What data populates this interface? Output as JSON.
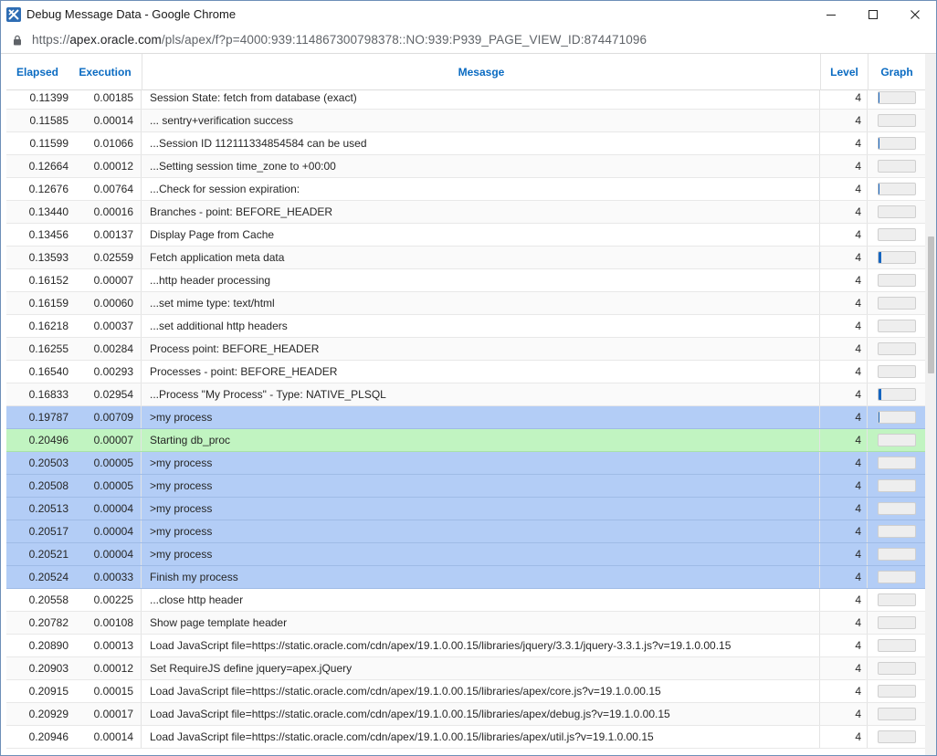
{
  "window": {
    "title": "Debug Message Data - Google Chrome",
    "url_prefix": "https://",
    "url_host": "apex.oracle.com",
    "url_path": "/pls/apex/f?p=4000:939:114867300798378::NO:939:P939_PAGE_VIEW_ID:874471096"
  },
  "table": {
    "headers": {
      "elapsed": "Elapsed",
      "execution": "Execution",
      "message": "Mesasge",
      "level": "Level",
      "graph": "Graph"
    },
    "rows": [
      {
        "elapsed": "0.11399",
        "execution": "0.00185",
        "message": "Session State: fetch from database (exact)",
        "level": "4",
        "graph": 0.03,
        "highlight": "none"
      },
      {
        "elapsed": "0.11585",
        "execution": "0.00014",
        "message": "... sentry+verification success",
        "level": "4",
        "graph": 0.0,
        "highlight": "none"
      },
      {
        "elapsed": "0.11599",
        "execution": "0.01066",
        "message": "...Session ID 112111334854584 can be used",
        "level": "4",
        "graph": 0.03,
        "highlight": "none"
      },
      {
        "elapsed": "0.12664",
        "execution": "0.00012",
        "message": "...Setting session time_zone to +00:00",
        "level": "4",
        "graph": 0.0,
        "highlight": "none"
      },
      {
        "elapsed": "0.12676",
        "execution": "0.00764",
        "message": "...Check for session expiration:",
        "level": "4",
        "graph": 0.03,
        "highlight": "none"
      },
      {
        "elapsed": "0.13440",
        "execution": "0.00016",
        "message": "Branches - point: BEFORE_HEADER",
        "level": "4",
        "graph": 0.0,
        "highlight": "none"
      },
      {
        "elapsed": "0.13456",
        "execution": "0.00137",
        "message": "Display Page from Cache",
        "level": "4",
        "graph": 0.0,
        "highlight": "none"
      },
      {
        "elapsed": "0.13593",
        "execution": "0.02559",
        "message": "Fetch application meta data",
        "level": "4",
        "graph": 0.07,
        "highlight": "none"
      },
      {
        "elapsed": "0.16152",
        "execution": "0.00007",
        "message": "...http header processing",
        "level": "4",
        "graph": 0.0,
        "highlight": "none"
      },
      {
        "elapsed": "0.16159",
        "execution": "0.00060",
        "message": "...set mime type: text/html",
        "level": "4",
        "graph": 0.0,
        "highlight": "none"
      },
      {
        "elapsed": "0.16218",
        "execution": "0.00037",
        "message": "...set additional http headers",
        "level": "4",
        "graph": 0.0,
        "highlight": "none"
      },
      {
        "elapsed": "0.16255",
        "execution": "0.00284",
        "message": "Process point: BEFORE_HEADER",
        "level": "4",
        "graph": 0.0,
        "highlight": "none"
      },
      {
        "elapsed": "0.16540",
        "execution": "0.00293",
        "message": "Processes - point: BEFORE_HEADER",
        "level": "4",
        "graph": 0.0,
        "highlight": "none"
      },
      {
        "elapsed": "0.16833",
        "execution": "0.02954",
        "message": "...Process \"My Process\" - Type: NATIVE_PLSQL",
        "level": "4",
        "graph": 0.08,
        "highlight": "none"
      },
      {
        "elapsed": "0.19787",
        "execution": "0.00709",
        "message": ">my process",
        "level": "4",
        "graph": 0.03,
        "highlight": "blue"
      },
      {
        "elapsed": "0.20496",
        "execution": "0.00007",
        "message": "Starting db_proc",
        "level": "4",
        "graph": 0.0,
        "highlight": "green"
      },
      {
        "elapsed": "0.20503",
        "execution": "0.00005",
        "message": ">my process",
        "level": "4",
        "graph": 0.0,
        "highlight": "blue"
      },
      {
        "elapsed": "0.20508",
        "execution": "0.00005",
        "message": ">my process",
        "level": "4",
        "graph": 0.0,
        "highlight": "blue"
      },
      {
        "elapsed": "0.20513",
        "execution": "0.00004",
        "message": ">my process",
        "level": "4",
        "graph": 0.0,
        "highlight": "blue"
      },
      {
        "elapsed": "0.20517",
        "execution": "0.00004",
        "message": ">my process",
        "level": "4",
        "graph": 0.0,
        "highlight": "blue"
      },
      {
        "elapsed": "0.20521",
        "execution": "0.00004",
        "message": ">my process",
        "level": "4",
        "graph": 0.0,
        "highlight": "blue"
      },
      {
        "elapsed": "0.20524",
        "execution": "0.00033",
        "message": "Finish my process",
        "level": "4",
        "graph": 0.0,
        "highlight": "blue"
      },
      {
        "elapsed": "0.20558",
        "execution": "0.00225",
        "message": "...close http header",
        "level": "4",
        "graph": 0.0,
        "highlight": "none"
      },
      {
        "elapsed": "0.20782",
        "execution": "0.00108",
        "message": "Show page template header",
        "level": "4",
        "graph": 0.0,
        "highlight": "none"
      },
      {
        "elapsed": "0.20890",
        "execution": "0.00013",
        "message": "Load JavaScript file=https://static.oracle.com/cdn/apex/19.1.0.00.15/libraries/jquery/3.3.1/jquery-3.3.1.js?v=19.1.0.00.15",
        "level": "4",
        "graph": 0.0,
        "highlight": "none"
      },
      {
        "elapsed": "0.20903",
        "execution": "0.00012",
        "message": "Set RequireJS define jquery=apex.jQuery",
        "level": "4",
        "graph": 0.0,
        "highlight": "none"
      },
      {
        "elapsed": "0.20915",
        "execution": "0.00015",
        "message": "Load JavaScript file=https://static.oracle.com/cdn/apex/19.1.0.00.15/libraries/apex/core.js?v=19.1.0.00.15",
        "level": "4",
        "graph": 0.0,
        "highlight": "none"
      },
      {
        "elapsed": "0.20929",
        "execution": "0.00017",
        "message": "Load JavaScript file=https://static.oracle.com/cdn/apex/19.1.0.00.15/libraries/apex/debug.js?v=19.1.0.00.15",
        "level": "4",
        "graph": 0.0,
        "highlight": "none"
      },
      {
        "elapsed": "0.20946",
        "execution": "0.00014",
        "message": "Load JavaScript file=https://static.oracle.com/cdn/apex/19.1.0.00.15/libraries/apex/util.js?v=19.1.0.00.15",
        "level": "4",
        "graph": 0.0,
        "highlight": "none"
      }
    ]
  },
  "colors": {
    "header_text": "#0a6bc2",
    "highlight_blue": "#b3cdf6",
    "highlight_green": "#c1f4c1",
    "graph_fill": "#1565c0"
  },
  "icons": {
    "app": "apex-debug-app-icon",
    "lock": "lock-icon",
    "minimize": "minimize-icon",
    "maximize": "maximize-icon",
    "close": "close-icon"
  }
}
